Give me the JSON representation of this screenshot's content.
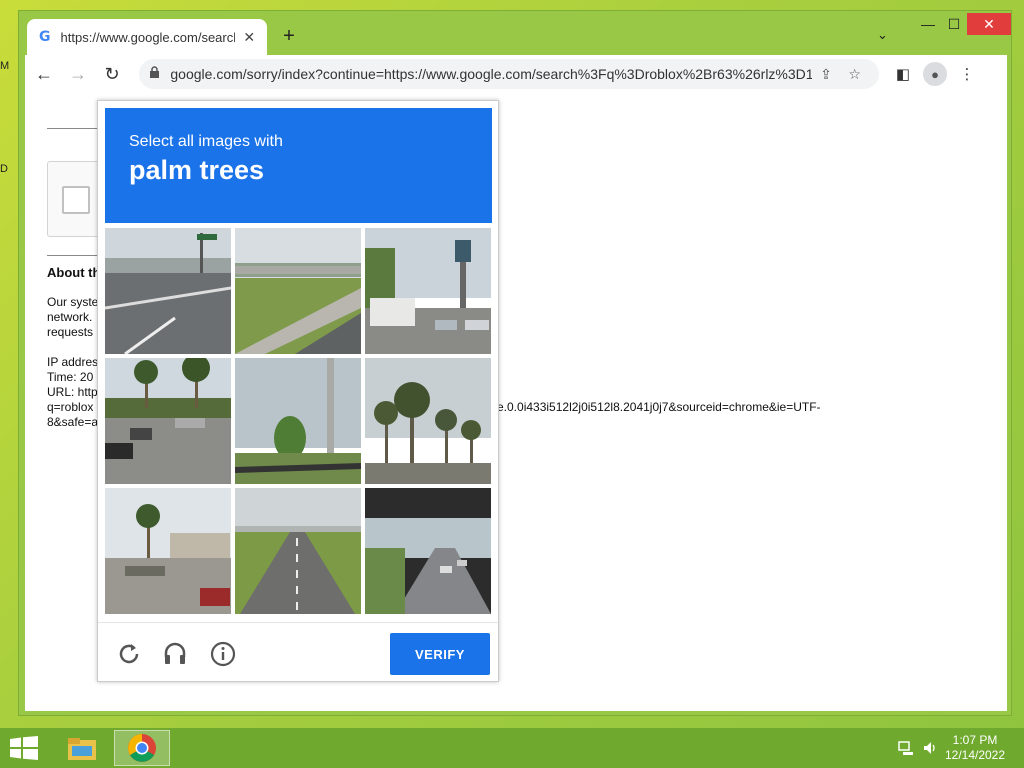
{
  "desktop": {
    "edge_letters": [
      "M",
      "D"
    ]
  },
  "browser": {
    "tab_title": "https://www.google.com/search?q=roblox",
    "url": "google.com/sorry/index?continue=https://www.google.com/search%3Fq%3Droblox%2Br63%26rlz%3D1C1...",
    "window_controls": {
      "minimize": "—",
      "maximize": "☐",
      "close": "✕"
    }
  },
  "page": {
    "about_heading": "About th",
    "lines": [
      "Our syste",
      "network.",
      "requests",
      "",
      "IP addres",
      "Time: 20",
      "URL: http",
      "q=roblox",
      "8&safe=a"
    ],
    "url_tail": "e.0.0i433i512l2j0i512l8.2041j0j7&sourceid=chrome&ie=UTF-"
  },
  "captcha": {
    "instruction": "Select all images with",
    "target": "palm trees",
    "verify_label": "VERIFY",
    "tiles": [
      {
        "scene": "intersection"
      },
      {
        "scene": "overpass-grass"
      },
      {
        "scene": "parking-rv"
      },
      {
        "scene": "palm-road"
      },
      {
        "scene": "pole-sky"
      },
      {
        "scene": "palm-cluster"
      },
      {
        "scene": "palm-street"
      },
      {
        "scene": "highway"
      },
      {
        "scene": "under-bridge"
      }
    ],
    "footer_icons": [
      "reload-icon",
      "audio-icon",
      "info-icon"
    ]
  },
  "taskbar": {
    "time": "1:07 PM",
    "date": "12/14/2022"
  },
  "colors": {
    "accent": "#1a73e8",
    "desktop": "#a9cf3e",
    "taskbar": "#6fa92d"
  }
}
